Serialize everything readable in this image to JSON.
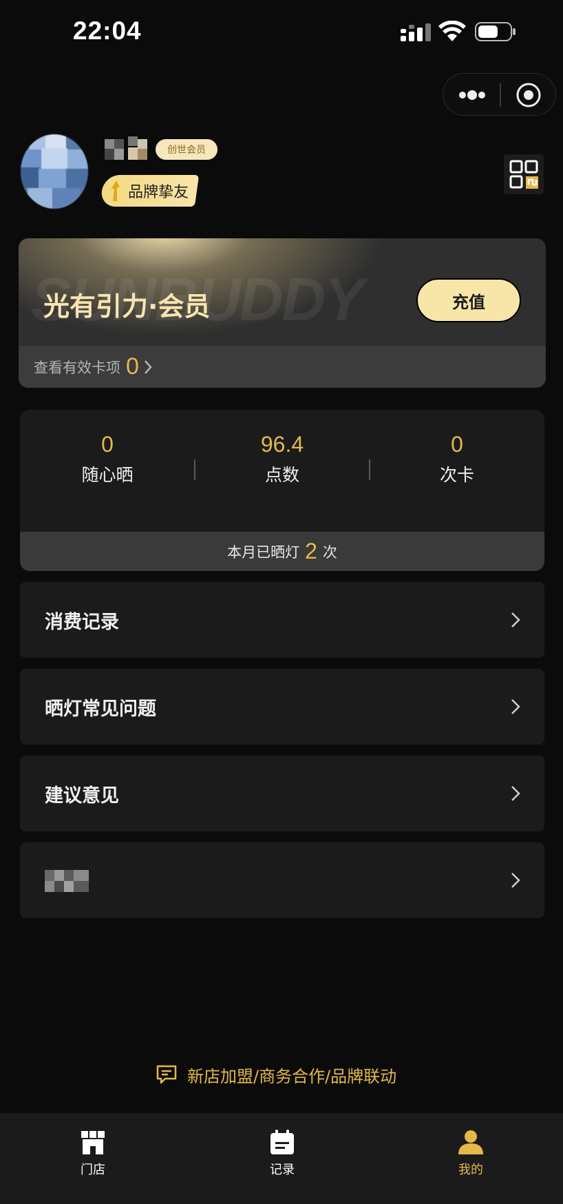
{
  "status_bar": {
    "time": "22:04"
  },
  "profile": {
    "member_badge": "创世会员",
    "tier": "品牌挚友"
  },
  "member_card": {
    "watermark": "SUNBUDDY",
    "title": "光有引力·会员",
    "recharge_label": "充值",
    "valid_items_label": "查看有效卡项",
    "valid_items_count": "0"
  },
  "stats": {
    "items": [
      {
        "value": "0",
        "label": "随心晒"
      },
      {
        "value": "96.4",
        "label": "点数"
      },
      {
        "value": "0",
        "label": "次卡"
      }
    ],
    "footer_prefix": "本月已晒灯",
    "footer_count": "2",
    "footer_suffix": "次"
  },
  "menu": {
    "items": [
      {
        "label": "消费记录"
      },
      {
        "label": "晒灯常见问题"
      },
      {
        "label": "建议意见"
      }
    ]
  },
  "contact": {
    "text": "新店加盟/商务合作/品牌联动"
  },
  "tab_bar": {
    "tabs": [
      {
        "label": "门店",
        "icon": "store-icon"
      },
      {
        "label": "记录",
        "icon": "calendar-icon"
      },
      {
        "label": "我的",
        "icon": "user-icon"
      }
    ],
    "active_index": 2,
    "accent": "#e6b84a"
  },
  "colors": {
    "accent": "#e6b84a",
    "card_gold": "#f8e6a9",
    "background": "#0b0b0b"
  }
}
